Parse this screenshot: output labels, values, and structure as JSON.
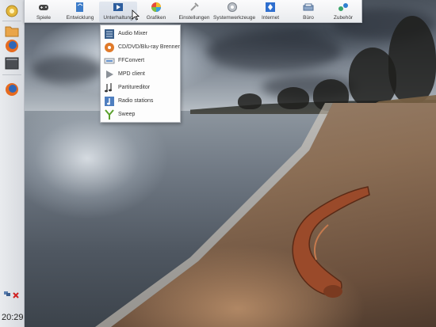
{
  "taskbar": {
    "categories": [
      {
        "label": "Spiele",
        "icon": "gamepad-icon"
      },
      {
        "label": "Entwicklung",
        "icon": "development-icon"
      },
      {
        "label": "Unterhaltung",
        "icon": "multimedia-icon"
      },
      {
        "label": "Grafiken",
        "icon": "graphics-icon"
      },
      {
        "label": "Einstellungen",
        "icon": "settings-icon"
      },
      {
        "label": "Systemwerkzeuge",
        "icon": "system-tools-icon"
      },
      {
        "label": "Internet",
        "icon": "internet-icon"
      },
      {
        "label": "Büro",
        "icon": "office-icon"
      },
      {
        "label": "Zubehör",
        "icon": "accessories-icon"
      }
    ],
    "active_category": "Unterhaltung"
  },
  "dropdown": {
    "items": [
      {
        "label": "Audio Mixer",
        "icon": "audio-mixer-icon"
      },
      {
        "label": "CD/DVD/Blu-ray Brenner",
        "icon": "disc-burner-icon"
      },
      {
        "label": "FFConvert",
        "icon": "ffconvert-icon"
      },
      {
        "label": "MPD client",
        "icon": "play-icon"
      },
      {
        "label": "Partitureditor",
        "icon": "music-score-icon"
      },
      {
        "label": "Radio stations",
        "icon": "radio-icon"
      },
      {
        "label": "Sweep",
        "icon": "sweep-icon"
      }
    ]
  },
  "left_panel": {
    "launchers": [
      "home-folder-icon",
      "firefox-icon",
      "terminal-icon",
      "firefox-icon"
    ],
    "clock": "20:29"
  },
  "colors": {
    "panel_bg": "#e9ebee",
    "accent": "#3a76c4"
  }
}
